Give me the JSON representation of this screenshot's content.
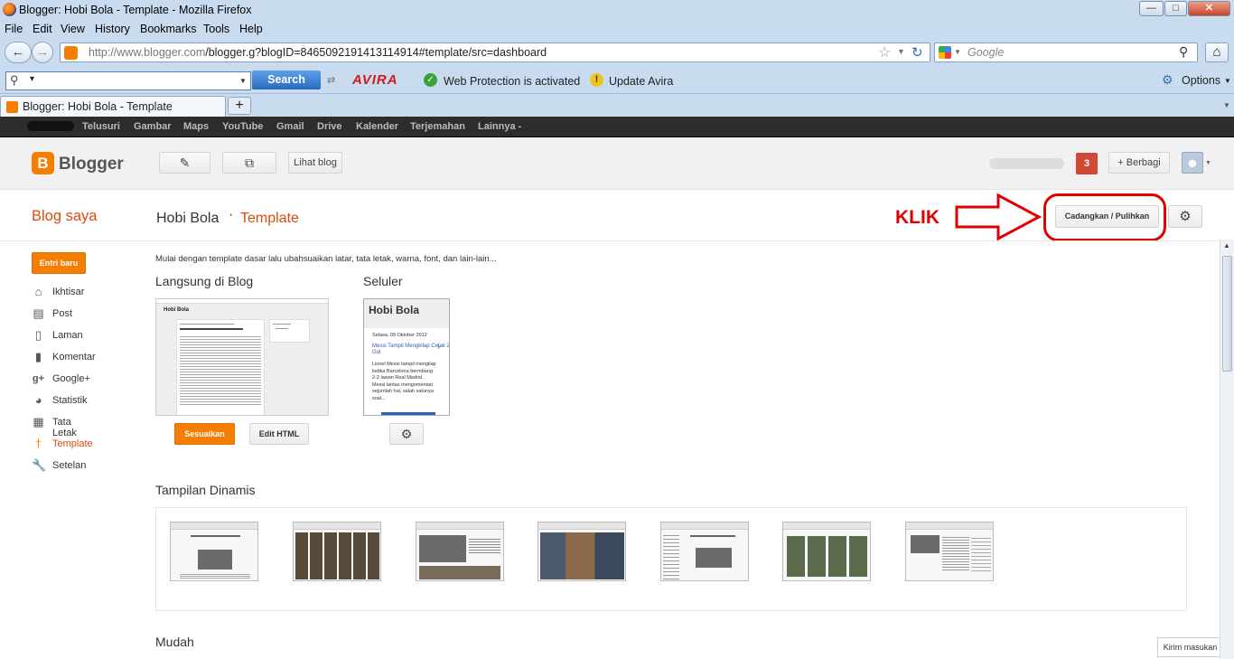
{
  "window": {
    "title": "Blogger: Hobi Bola - Template - Mozilla Firefox"
  },
  "menu": [
    "File",
    "Edit",
    "View",
    "History",
    "Bookmarks",
    "Tools",
    "Help"
  ],
  "nav": {
    "url_host": "http://www.blogger.com",
    "url_path": "/blogger.g?blogID=8465092191413114914#template/src=dashboard",
    "search_placeholder": "Google"
  },
  "avira": {
    "search_button": "Search",
    "brand": "AVIRA",
    "web_protection": "Web Protection is activated",
    "update": "Update Avira",
    "options": "Options"
  },
  "tab": {
    "title": "Blogger: Hobi Bola - Template",
    "new_tab": "+"
  },
  "google_bar": [
    "Telusuri",
    "Gambar",
    "Maps",
    "YouTube",
    "Gmail",
    "Drive",
    "Kalender",
    "Terjemahan",
    "Lainnya -"
  ],
  "blogger": {
    "brand": "Blogger",
    "view_blog": "Lihat blog",
    "notifications": "3",
    "share": "+ Berbagi"
  },
  "page": {
    "my_blogs": "Blog saya",
    "blog_name": "Hobi Bola",
    "separator": "·",
    "section": "Template",
    "annotation": "KLIK",
    "backup_button": "Cadangkan / Pulihkan",
    "intro": "Mulai dengan template dasar lalu ubahsuaikan latar, tata letak, warna, font, dan lain-lain...",
    "live_heading": "Langsung di Blog",
    "mobile_heading": "Seluler",
    "customize_button": "Sesuaikan",
    "edit_html_button": "Edit HTML",
    "dynamic_heading": "Tampilan Dinamis",
    "easy_heading": "Mudah",
    "feedback": "Kirim masukan"
  },
  "sidebar": {
    "new_post": "Entri baru",
    "items": [
      {
        "label": "Ikhtisar",
        "icon": "home-icon"
      },
      {
        "label": "Post",
        "icon": "posts-icon"
      },
      {
        "label": "Laman",
        "icon": "pages-icon"
      },
      {
        "label": "Komentar",
        "icon": "comment-icon"
      },
      {
        "label": "Google+",
        "icon": "google-plus-icon"
      },
      {
        "label": "Statistik",
        "icon": "stats-icon"
      },
      {
        "label": "Tata Letak",
        "icon": "layout-icon"
      },
      {
        "label": "Template",
        "icon": "template-icon"
      },
      {
        "label": "Setelan",
        "icon": "wrench-icon"
      }
    ]
  },
  "preview": {
    "blog_title": "Hobi Bola",
    "mobile_title": "Hobi Bola",
    "mobile_date": "Selasa, 09 Oktober 2012",
    "mobile_post_title": "Messi Tampil Mengkilap Cetak 2 Gol",
    "mobile_excerpt": "Lionel Messi tampil mengilap ketika Barcelona bermbang 2-2 lawan Real Madrid. Messi lantas mengomentari sejumlah hal, salah satunya soal..."
  },
  "colors": {
    "accent": "#f57d00",
    "annotation_red": "#e00000",
    "notification": "#d14836"
  }
}
